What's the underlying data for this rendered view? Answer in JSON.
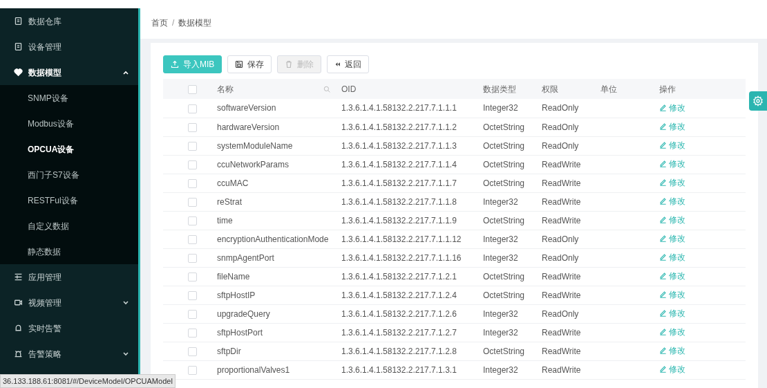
{
  "sidebar": {
    "items": [
      {
        "label": "数据仓库"
      },
      {
        "label": "设备管理"
      },
      {
        "label": "数据模型",
        "expanded": true,
        "children": [
          {
            "label": "SNMP设备",
            "selected": false
          },
          {
            "label": "Modbus设备",
            "selected": false
          },
          {
            "label": "OPCUA设备",
            "selected": true
          },
          {
            "label": "西门子S7设备",
            "selected": false
          },
          {
            "label": "RESTFul设备",
            "selected": false
          },
          {
            "label": "自定义数据",
            "selected": false
          },
          {
            "label": "静态数据",
            "selected": false
          }
        ]
      },
      {
        "label": "应用管理"
      },
      {
        "label": "视频管理",
        "expanded": false
      },
      {
        "label": "实时告警"
      },
      {
        "label": "告警策略",
        "expanded": false
      }
    ]
  },
  "breadcrumb": {
    "items": [
      "首页",
      "数据模型"
    ],
    "separator": "/"
  },
  "toolbar": {
    "buttons": [
      {
        "label": "导入MIB",
        "kind": "primary",
        "disabled": false
      },
      {
        "label": "保存",
        "kind": "save",
        "disabled": false
      },
      {
        "label": "删除",
        "kind": "delete",
        "disabled": true
      },
      {
        "label": "返回",
        "kind": "back",
        "disabled": false
      }
    ]
  },
  "table": {
    "select_all_checked": false,
    "columns": [
      "名称",
      "OID",
      "数据类型",
      "权限",
      "单位",
      "操作"
    ],
    "rows": [
      {
        "checked": false,
        "name": "softwareVersion",
        "oid": "1.3.6.1.4.1.58132.2.217.7.1.1.1",
        "type": "Integer32",
        "access": "ReadOnly",
        "action": "修改"
      },
      {
        "checked": false,
        "name": "hardwareVersion",
        "oid": "1.3.6.1.4.1.58132.2.217.7.1.1.2",
        "type": "OctetString",
        "access": "ReadOnly",
        "action": "修改"
      },
      {
        "checked": false,
        "name": "systemModuleName",
        "oid": "1.3.6.1.4.1.58132.2.217.7.1.1.3",
        "type": "OctetString",
        "access": "ReadOnly",
        "action": "修改"
      },
      {
        "checked": false,
        "name": "ccuNetworkParams",
        "oid": "1.3.6.1.4.1.58132.2.217.7.1.1.4",
        "type": "OctetString",
        "access": "ReadWrite",
        "action": "修改"
      },
      {
        "checked": false,
        "name": "ccuMAC",
        "oid": "1.3.6.1.4.1.58132.2.217.7.1.1.7",
        "type": "OctetString",
        "access": "ReadWrite",
        "action": "修改"
      },
      {
        "checked": false,
        "name": "reStrat",
        "oid": "1.3.6.1.4.1.58132.2.217.7.1.1.8",
        "type": "Integer32",
        "access": "ReadWrite",
        "action": "修改"
      },
      {
        "checked": false,
        "name": "time",
        "oid": "1.3.6.1.4.1.58132.2.217.7.1.1.9",
        "type": "OctetString",
        "access": "ReadWrite",
        "action": "修改"
      },
      {
        "checked": false,
        "name": "encryptionAuthenticationMode",
        "oid": "1.3.6.1.4.1.58132.2.217.7.1.1.12",
        "type": "Integer32",
        "access": "ReadOnly",
        "action": "修改"
      },
      {
        "checked": false,
        "name": "snmpAgentPort",
        "oid": "1.3.6.1.4.1.58132.2.217.7.1.1.16",
        "type": "Integer32",
        "access": "ReadOnly",
        "action": "修改"
      },
      {
        "checked": false,
        "name": "fileName",
        "oid": "1.3.6.1.4.1.58132.2.217.7.1.2.1",
        "type": "OctetString",
        "access": "ReadWrite",
        "action": "修改"
      },
      {
        "checked": false,
        "name": "sftpHostIP",
        "oid": "1.3.6.1.4.1.58132.2.217.7.1.2.4",
        "type": "OctetString",
        "access": "ReadWrite",
        "action": "修改"
      },
      {
        "checked": false,
        "name": "upgradeQuery",
        "oid": "1.3.6.1.4.1.58132.2.217.7.1.2.6",
        "type": "Integer32",
        "access": "ReadOnly",
        "action": "修改"
      },
      {
        "checked": false,
        "name": "sftpHostPort",
        "oid": "1.3.6.1.4.1.58132.2.217.7.1.2.7",
        "type": "Integer32",
        "access": "ReadWrite",
        "action": "修改"
      },
      {
        "checked": false,
        "name": "sftpDir",
        "oid": "1.3.6.1.4.1.58132.2.217.7.1.2.8",
        "type": "OctetString",
        "access": "ReadWrite",
        "action": "修改"
      },
      {
        "checked": false,
        "name": "proportionalValves1",
        "oid": "1.3.6.1.4.1.58132.2.217.7.1.3.1",
        "type": "Integer32",
        "access": "ReadWrite",
        "action": "修改"
      }
    ]
  },
  "status_bar": {
    "url": "36.133.188.61:8081/#/DeviceModel/OPCUAModel"
  }
}
